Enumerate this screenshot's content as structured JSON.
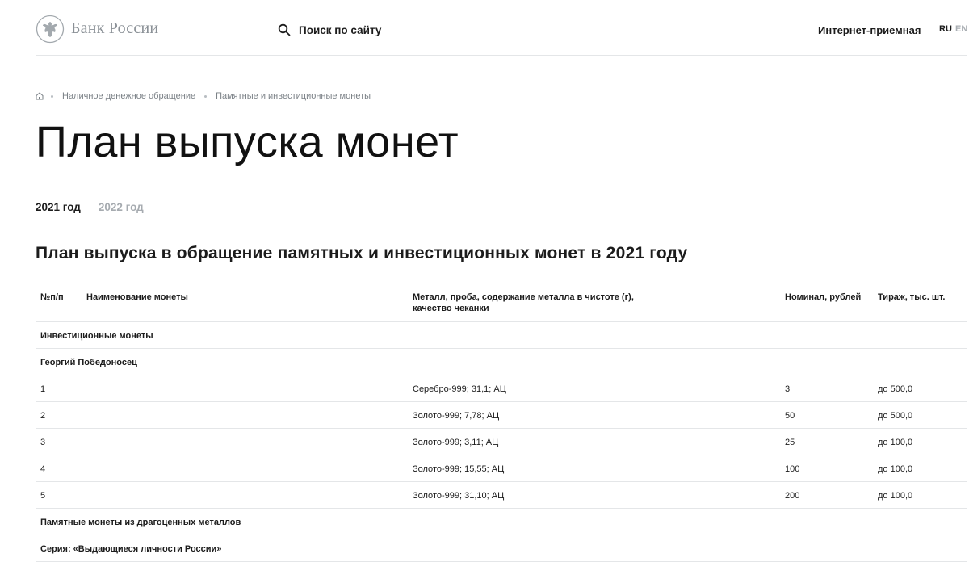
{
  "header": {
    "logo_text": "Банк России",
    "search_label": "Поиск по сайту",
    "reception_label": "Интернет-приемная",
    "lang_ru": "RU",
    "lang_en": "EN"
  },
  "breadcrumb": {
    "items": [
      "Наличное денежное обращение",
      "Памятные и инвестиционные монеты"
    ]
  },
  "page_title": "План выпуска монет",
  "tabs": [
    {
      "label": "2021 год",
      "active": true
    },
    {
      "label": "2022 год",
      "active": false
    }
  ],
  "section_title": "План выпуска в обращение памятных и инвестиционных монет в 2021 году",
  "table": {
    "headers": {
      "num": "№п/п",
      "name": "Наименование монеты",
      "metal_line1": "Металл, проба, содержание металла в чистоте (г),",
      "metal_line2": "качество чеканки",
      "denomination": "Номинал, рублей",
      "mintage": "Тираж, тыс. шт."
    },
    "group1": "Инвестиционные монеты",
    "subgroup1": "Георгий Победоносец",
    "rows": [
      {
        "num": "1",
        "metal": "Серебро-999; 31,1; АЦ",
        "denomination": "3",
        "mintage": "до 500,0"
      },
      {
        "num": "2",
        "metal": "Золото-999; 7,78; АЦ",
        "denomination": "50",
        "mintage": "до 500,0"
      },
      {
        "num": "3",
        "metal": "Золото-999; 3,11; АЦ",
        "denomination": "25",
        "mintage": "до 100,0"
      },
      {
        "num": "4",
        "metal": "Золото-999; 15,55; АЦ",
        "denomination": "100",
        "mintage": "до 100,0"
      },
      {
        "num": "5",
        "metal": "Золото-999; 31,10; АЦ",
        "denomination": "200",
        "mintage": "до 100,0"
      }
    ],
    "group2": "Памятные монеты из драгоценных металлов",
    "subgroup2": "Серия: «Выдающиеся личности России»"
  },
  "icons": {
    "logo": "double-headed-eagle-emblem",
    "search": "search-icon",
    "home": "home-icon"
  },
  "colors": {
    "text": "#1c1c1c",
    "muted": "#7a8086",
    "inactive_tab": "#a6abb0",
    "divider": "#e4e6e8"
  }
}
